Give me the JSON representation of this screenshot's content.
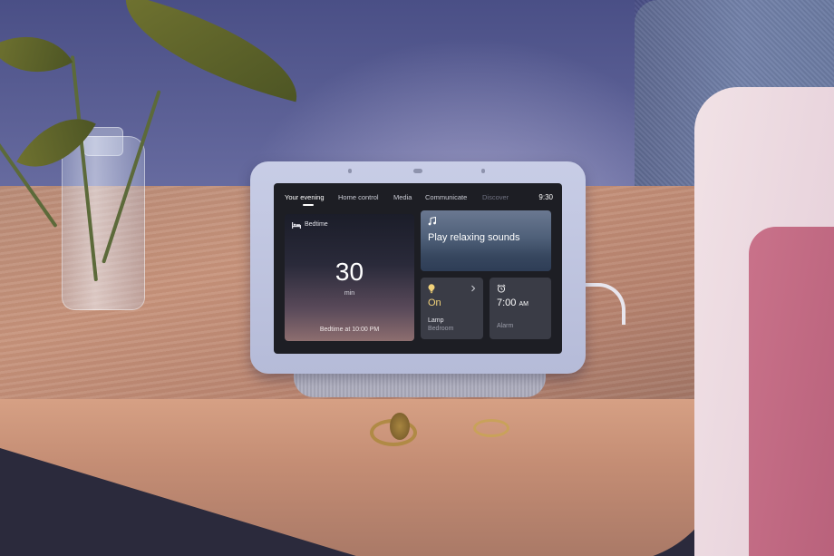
{
  "tabs": [
    {
      "label": "Your evening"
    },
    {
      "label": "Home control"
    },
    {
      "label": "Media"
    },
    {
      "label": "Communicate"
    },
    {
      "label": "Discover"
    }
  ],
  "clock": "9:30",
  "bedtime": {
    "title": "Bedtime",
    "value": "30",
    "unit": "min",
    "footer": "Bedtime at 10:00 PM",
    "icon": "bed-icon"
  },
  "sounds": {
    "title": "Play relaxing sounds",
    "icon": "music-note-icon"
  },
  "lamp": {
    "state": "On",
    "name": "Lamp",
    "room": "Bedroom",
    "icon": "lightbulb-icon",
    "accent": "#f2d27a"
  },
  "alarm": {
    "time": "7:00",
    "ampm": "AM",
    "label": "Alarm",
    "icon": "alarm-clock-icon"
  }
}
